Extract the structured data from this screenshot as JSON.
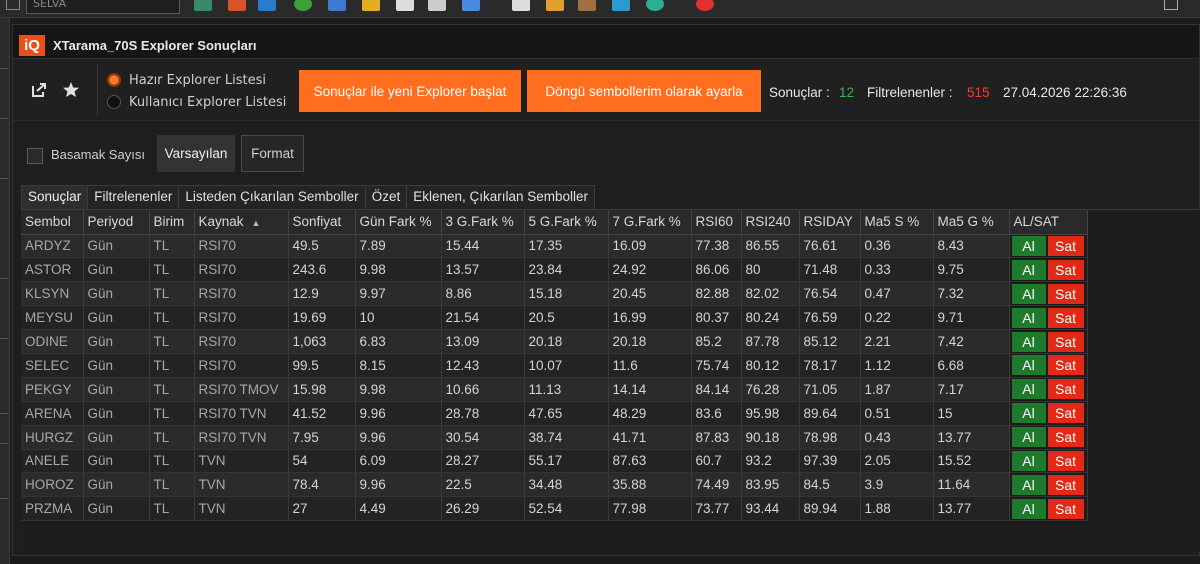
{
  "top_toolbar": {
    "symbol_combo_value": "SELVA"
  },
  "window": {
    "logo": "iQ",
    "title": "XTarama_70S Explorer Sonuçları"
  },
  "toolbar": {
    "radio_options": [
      {
        "label": "Hazır Explorer Listesi",
        "selected": true
      },
      {
        "label": "Kullanıcı Explorer Listesi",
        "selected": false
      }
    ],
    "start_new_explorer_label": "Sonuçlar ile yeni Explorer başlat",
    "set_loop_symbols_label": "Döngü sembollerim olarak ayarla",
    "results_label": "Sonuçlar :",
    "results_count": "12",
    "filtered_label": "Filtrelenenler :",
    "filtered_count": "515",
    "datetime": "27.04.2026 22:26:36"
  },
  "options": {
    "digits_label": "Basamak Sayısı",
    "defaults_label": "Varsayılan",
    "format_label": "Format"
  },
  "tabs": [
    "Sonuçlar",
    "Filtrelenenler",
    "Listeden Çıkarılan Semboller",
    "Özet",
    "Eklenen, Çıkarılan Semboller"
  ],
  "table": {
    "columns": [
      "Sembol",
      "Periyod",
      "Birim",
      "Kaynak",
      "Sonfiyat",
      "Gün Fark %",
      "3 G.Fark %",
      "5 G.Fark %",
      "7 G.Fark %",
      "RSI60",
      "RSI240",
      "RSIDAY",
      "Ma5 S %",
      "Ma5 G %",
      "AL/SAT"
    ],
    "buy_label": "Al",
    "sell_label": "Sat",
    "rows": [
      [
        "ARDYZ",
        "Gün",
        "TL",
        "RSI70",
        "49.5",
        "7.89",
        "15.44",
        "17.35",
        "16.09",
        "77.38",
        "86.55",
        "76.61",
        "0.36",
        "8.43"
      ],
      [
        "ASTOR",
        "Gün",
        "TL",
        "RSI70",
        "243.6",
        "9.98",
        "13.57",
        "23.84",
        "24.92",
        "86.06",
        "80",
        "71.48",
        "0.33",
        "9.75"
      ],
      [
        "KLSYN",
        "Gün",
        "TL",
        "RSI70",
        "12.9",
        "9.97",
        "8.86",
        "15.18",
        "20.45",
        "82.88",
        "82.02",
        "76.54",
        "0.47",
        "7.32"
      ],
      [
        "MEYSU",
        "Gün",
        "TL",
        "RSI70",
        "19.69",
        "10",
        "21.54",
        "20.5",
        "16.99",
        "80.37",
        "80.24",
        "76.59",
        "0.22",
        "9.71"
      ],
      [
        "ODINE",
        "Gün",
        "TL",
        "RSI70",
        "1,063",
        "6.83",
        "13.09",
        "20.18",
        "20.18",
        "85.2",
        "87.78",
        "85.12",
        "2.21",
        "7.42"
      ],
      [
        "SELEC",
        "Gün",
        "TL",
        "RSI70",
        "99.5",
        "8.15",
        "12.43",
        "10.07",
        "11.6",
        "75.74",
        "80.12",
        "78.17",
        "1.12",
        "6.68"
      ],
      [
        "PEKGY",
        "Gün",
        "TL",
        "RSI70 TMOV",
        "15.98",
        "9.98",
        "10.66",
        "11.13",
        "14.14",
        "84.14",
        "76.28",
        "71.05",
        "1.87",
        "7.17"
      ],
      [
        "ARENA",
        "Gün",
        "TL",
        "RSI70 TVN",
        "41.52",
        "9.96",
        "28.78",
        "47.65",
        "48.29",
        "83.6",
        "95.98",
        "89.64",
        "0.51",
        "15"
      ],
      [
        "HURGZ",
        "Gün",
        "TL",
        "RSI70 TVN",
        "7.95",
        "9.96",
        "30.54",
        "38.74",
        "41.71",
        "87.83",
        "90.18",
        "78.98",
        "0.43",
        "13.77"
      ],
      [
        "ANELE",
        "Gün",
        "TL",
        "TVN",
        "54",
        "6.09",
        "28.27",
        "55.17",
        "87.63",
        "60.7",
        "93.2",
        "97.39",
        "2.05",
        "15.52"
      ],
      [
        "HOROZ",
        "Gün",
        "TL",
        "TVN",
        "78.4",
        "9.96",
        "22.5",
        "34.48",
        "35.88",
        "74.49",
        "83.95",
        "84.5",
        "3.9",
        "11.64"
      ],
      [
        "PRZMA",
        "Gün",
        "TL",
        "TVN",
        "27",
        "4.49",
        "26.29",
        "52.54",
        "77.98",
        "73.77",
        "93.44",
        "89.94",
        "1.88",
        "13.77"
      ]
    ]
  }
}
